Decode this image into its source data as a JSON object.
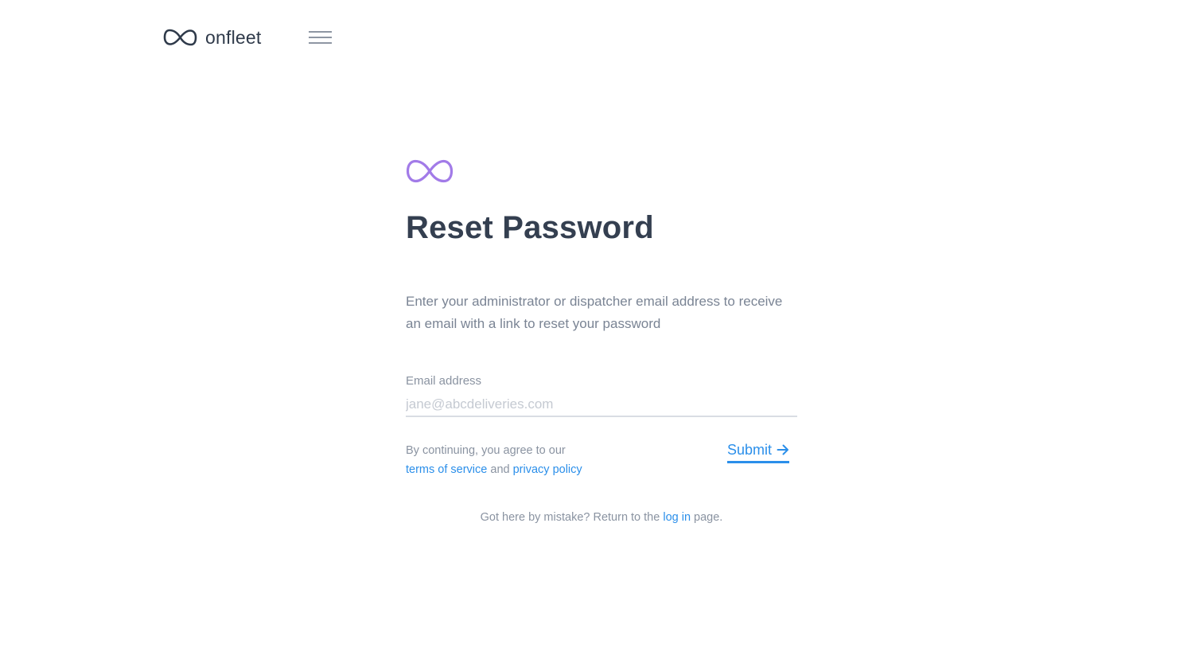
{
  "header": {
    "brand_name": "onfleet",
    "logo_icon": "infinity-icon",
    "menu_icon": "hamburger-menu-icon"
  },
  "card": {
    "logo_icon": "infinity-icon",
    "title": "Reset Password",
    "description": "Enter your administrator or dispatcher email address to receive an email with a link to reset your password",
    "email_label": "Email address",
    "email_placeholder": "jane@abcdeliveries.com",
    "email_value": "",
    "consent_prefix": "By continuing, you agree to our",
    "terms_link": "terms of service",
    "consent_and": "and",
    "privacy_link": "privacy policy",
    "submit_label": "Submit",
    "submit_icon": "arrow-right-icon"
  },
  "footer": {
    "prefix": "Got here by mistake? Return to the",
    "login_link": "log in",
    "suffix": "page."
  },
  "colors": {
    "brand_dark": "#2f3a4a",
    "accent_purple": "#a27be8",
    "link_blue": "#2b8fea",
    "muted_text": "#7a8494"
  }
}
